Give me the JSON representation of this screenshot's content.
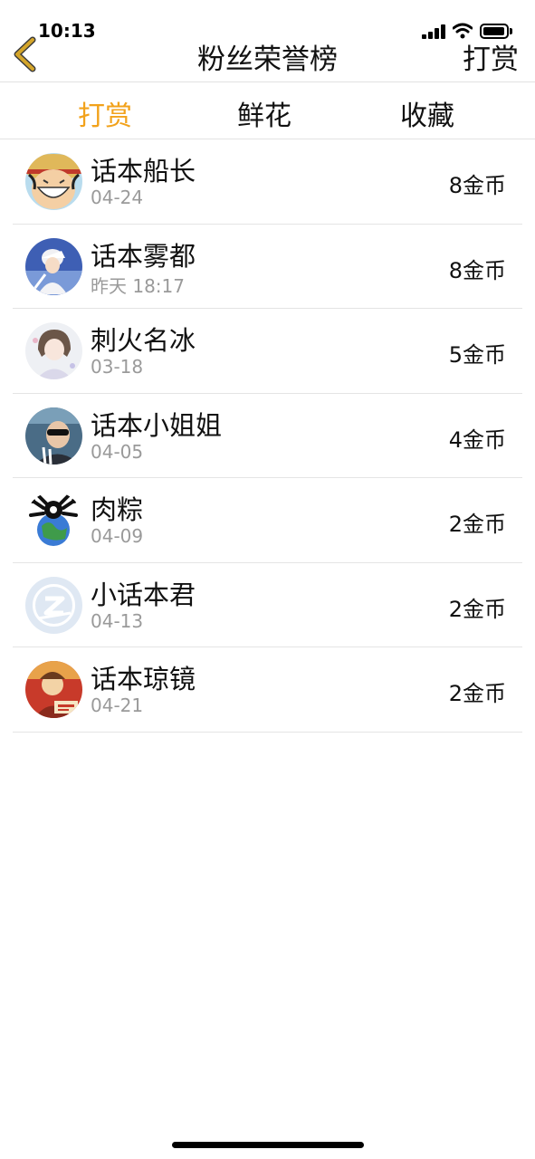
{
  "status_bar": {
    "time": "10:13",
    "icons": [
      "cellular-signal-icon",
      "wifi-icon",
      "battery-icon"
    ]
  },
  "nav": {
    "back_icon": "chevron-left-icon",
    "back_icon_color": "#d4a52a",
    "title": "粉丝荣誉榜",
    "action_label": "打赏"
  },
  "tabs": [
    {
      "label": "打赏",
      "active": true
    },
    {
      "label": "鲜花",
      "active": false
    },
    {
      "label": "收藏",
      "active": false
    }
  ],
  "colors": {
    "accent": "#f2a21b",
    "secondary_text": "#9a9a9a",
    "divider": "#e4e4e4"
  },
  "fans": [
    {
      "name": "话本船长",
      "date": "04-24",
      "amount": "8金币",
      "avatar": "pirate-cartoon-avatar"
    },
    {
      "name": "话本雾都",
      "date": "昨天 18:17",
      "amount": "8金币",
      "avatar": "anime-character-avatar"
    },
    {
      "name": "刺火名冰",
      "date": "03-18",
      "amount": "5金币",
      "avatar": "sketch-girl-avatar"
    },
    {
      "name": "话本小姐姐",
      "date": "04-05",
      "amount": "4金币",
      "avatar": "sunglasses-portrait-avatar"
    },
    {
      "name": "肉粽",
      "date": "04-09",
      "amount": "2金币",
      "avatar": "earth-emblem-avatar"
    },
    {
      "name": "小话本君",
      "date": "04-13",
      "amount": "2金币",
      "avatar": "default-z-avatar"
    },
    {
      "name": "话本琼镜",
      "date": "04-21",
      "amount": "2金币",
      "avatar": "comic-character-avatar"
    }
  ]
}
